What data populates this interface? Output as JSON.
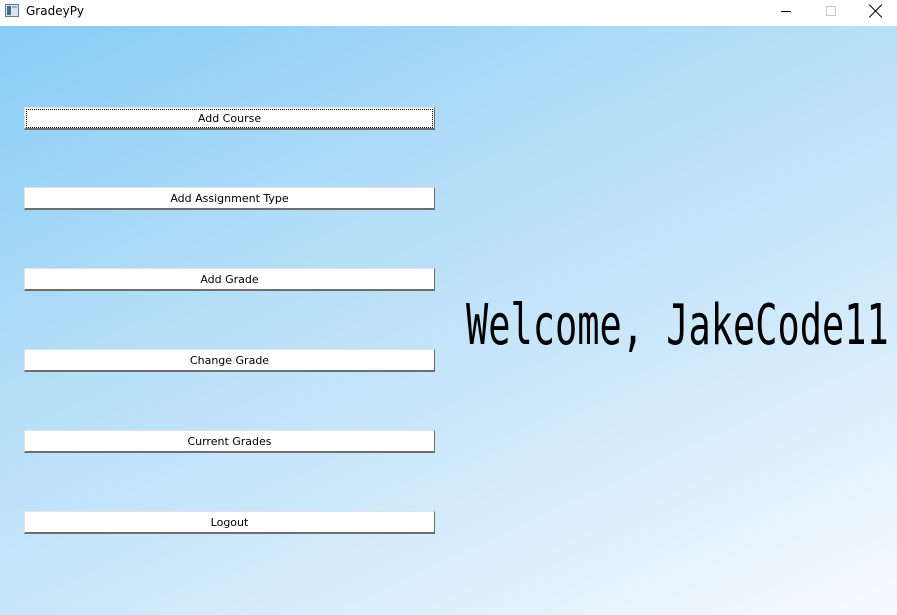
{
  "window": {
    "title": "GradeyPy",
    "icon": "app-window-icon"
  },
  "main": {
    "buttons": [
      {
        "label": "Add Course"
      },
      {
        "label": "Add Assignment Type"
      },
      {
        "label": "Add Grade"
      },
      {
        "label": "Change Grade"
      },
      {
        "label": "Current Grades"
      },
      {
        "label": "Logout"
      }
    ],
    "welcome_text": "Welcome, JakeCode11"
  },
  "colors": {
    "background_gradient_start": "#88ccf6",
    "background_gradient_end": "#f7fbff"
  }
}
